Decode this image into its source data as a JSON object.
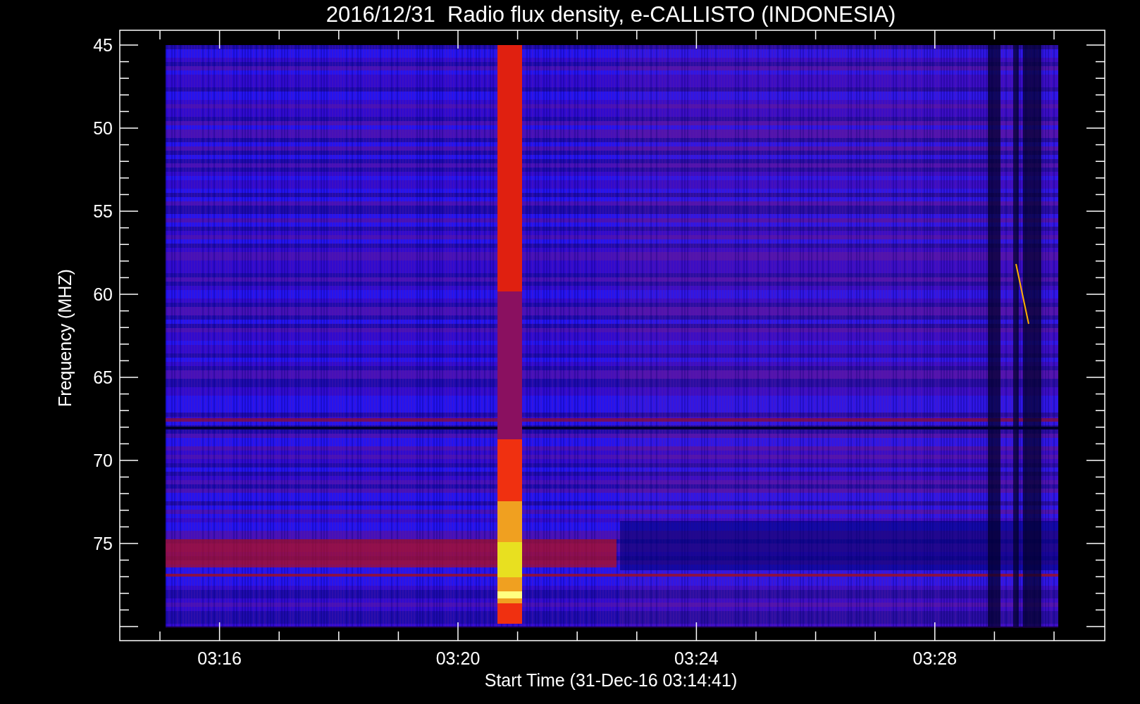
{
  "title": "2016/12/31  Radio flux density, e-CALLISTO (INDONESIA)",
  "y_axis": {
    "label": "Frequency (MHZ)",
    "ticks": [
      "45",
      "50",
      "55",
      "60",
      "65",
      "70",
      "75"
    ]
  },
  "x_axis": {
    "label": "Start Time (31-Dec-16 03:14:41)",
    "ticks": [
      "03:16",
      "03:20",
      "03:24",
      "03:28"
    ]
  }
}
